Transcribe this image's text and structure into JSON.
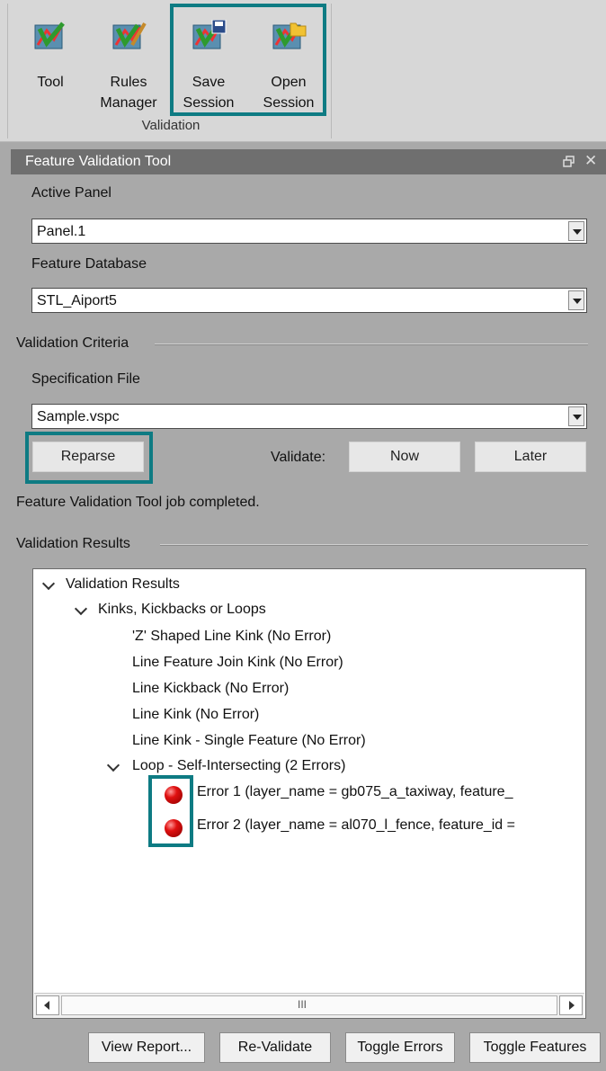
{
  "ribbon": {
    "buttons": [
      {
        "id": "tool",
        "line1": "Tool",
        "line2": ""
      },
      {
        "id": "rules",
        "line1": "Rules",
        "line2": "Manager"
      },
      {
        "id": "save",
        "line1": "Save",
        "line2": "Session"
      },
      {
        "id": "open",
        "line1": "Open",
        "line2": "Session"
      }
    ],
    "group_label": "Validation"
  },
  "panel": {
    "title": "Feature Validation Tool",
    "title_icons": {
      "restore": "restore-icon",
      "close": "✕"
    },
    "active_panel_label": "Active Panel",
    "active_panel_value": "Panel.1",
    "feature_db_label": "Feature Database",
    "feature_db_value": "STL_Aiport5",
    "criteria_label": "Validation Criteria",
    "spec_file_label": "Specification File",
    "spec_file_value": "Sample.vspc",
    "reparse_label": "Reparse",
    "validate_label": "Validate:",
    "now_label": "Now",
    "later_label": "Later",
    "status_text": "Feature Validation Tool job completed.",
    "results_label": "Validation Results"
  },
  "tree": {
    "root": "Validation Results",
    "group1": "Kinks, Kickbacks or Loops",
    "items": [
      "'Z' Shaped Line Kink (No Error)",
      "Line Feature Join Kink (No Error)",
      "Line Kickback (No Error)",
      "Line Kink (No Error)",
      "Line Kink - Single Feature (No Error)"
    ],
    "group2": "Loop - Self-Intersecting (2 Errors)",
    "errors": [
      "Error 1 (layer_name = gb075_a_taxiway, feature_",
      "Error 2 (layer_name = al070_l_fence, feature_id ="
    ],
    "scroll_grip": "III"
  },
  "bottom_buttons": {
    "view_report": "View Report...",
    "revalidate": "Re-Validate",
    "toggle_errors": "Toggle Errors",
    "toggle_features": "Toggle Features"
  },
  "colors": {
    "highlight": "#0e7b83",
    "error": "#e01010",
    "title_bar": "#6f6f6f"
  }
}
